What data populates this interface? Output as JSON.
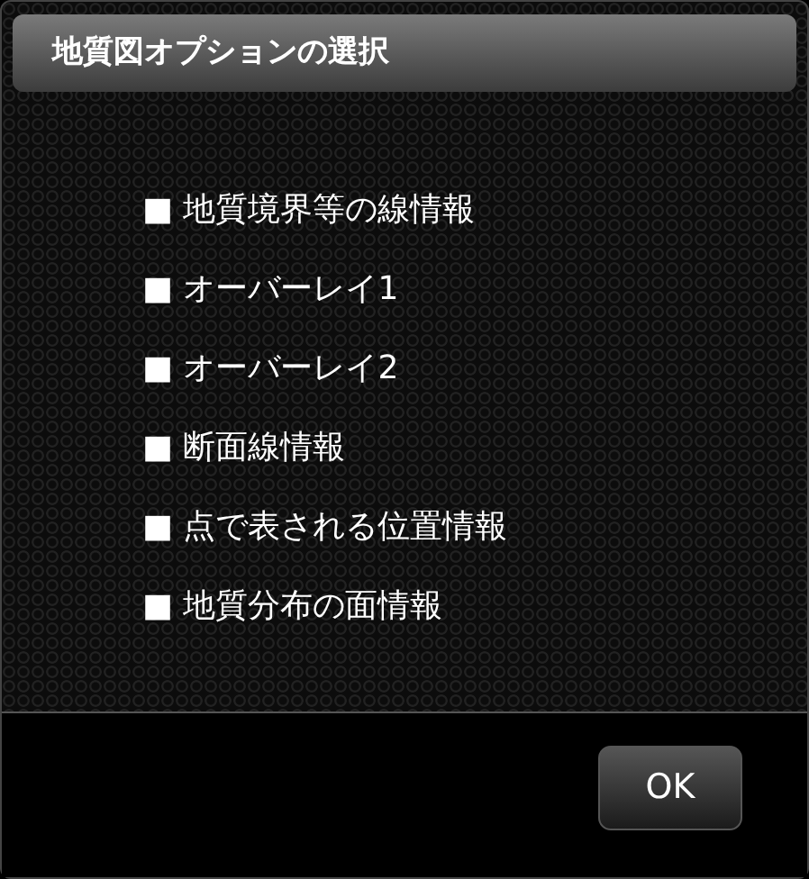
{
  "dialog": {
    "title": "地質図オプションの選択",
    "options": [
      {
        "label": "■ 地質境界等の線情報"
      },
      {
        "label": "■ オーバーレイ1"
      },
      {
        "label": "■ オーバーレイ2"
      },
      {
        "label": "■ 断面線情報"
      },
      {
        "label": "■ 点で表される位置情報"
      },
      {
        "label": "■ 地質分布の面情報"
      }
    ],
    "buttons": [
      "OK"
    ]
  }
}
